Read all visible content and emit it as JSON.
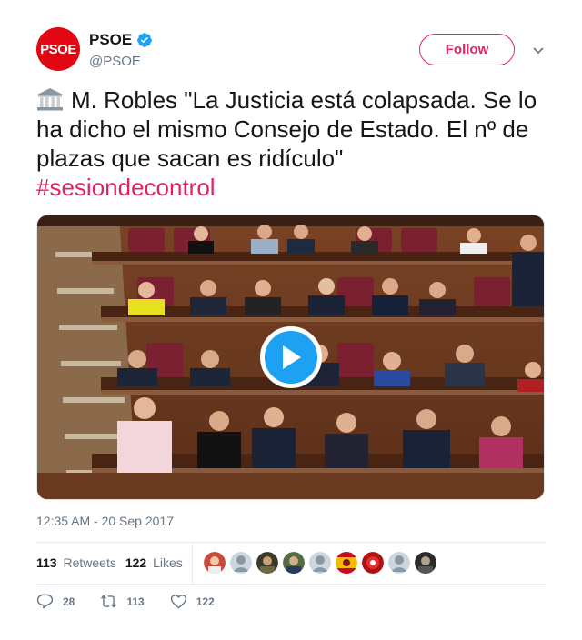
{
  "account": {
    "avatar_text": "PSOE",
    "display_name": "PSOE",
    "handle": "@PSOE",
    "follow_label": "Follow",
    "verified": true
  },
  "tweet": {
    "emoji_icon": "classical-building-icon",
    "text": "M. Robles \"La Justicia está colapsada. Se lo ha dicho el mismo Consejo de Estado. El nº de plazas que sacan es ridículo\"",
    "hashtag": "#sesiondecontrol"
  },
  "media": {
    "type": "video",
    "play_icon": "play-icon"
  },
  "timestamp": "12:35 AM - 20 Sep 2017",
  "stats": {
    "retweets_count": "113",
    "retweets_label": "Retweets",
    "likes_count": "122",
    "likes_label": "Likes",
    "liker_avatars": 9
  },
  "actions": {
    "replies": "28",
    "retweets": "113",
    "likes": "122"
  },
  "colors": {
    "brand_red": "#e30613",
    "accent_pink": "#e0245e",
    "verified_blue": "#1da1f2",
    "muted": "#657786"
  }
}
